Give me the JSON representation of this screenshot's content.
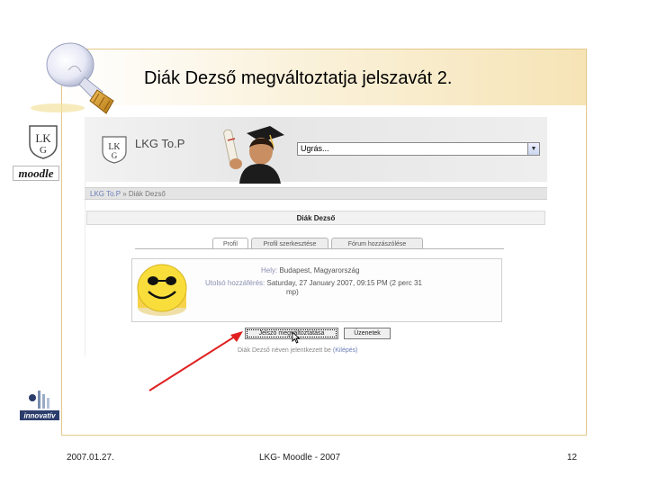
{
  "slide": {
    "title": "Diák Dezső megváltoztatja jelszavát 2.",
    "footer_date": "2007.01.27.",
    "footer_center": "LKG- Moodle - 2007",
    "page_number": "12"
  },
  "logos": {
    "moodle": "moodle",
    "innov_text": "innovatív"
  },
  "moodle_page": {
    "site_name": "LKG To.P",
    "jump_select": "Ugrás...",
    "breadcrumb_site": "LKG To.P",
    "breadcrumb_sep": "»",
    "breadcrumb_user": "Diák Dezső",
    "user_heading": "Diák Dezső",
    "tabs": [
      "Profil",
      "Profil szerkesztése",
      "Fórum hozzászólése"
    ],
    "place_label": "Hely:",
    "place_value": "Budapest, Magyarország",
    "last_access_label": "Utolsó hozzáférés:",
    "last_access_value": "Saturday, 27 January 2007, 09:15 PM  (2 perc 31",
    "last_access_value2": "mp)",
    "change_password_button": "Jelszó megváltoztatása",
    "messages_button": "Üzenetek",
    "logged_in_prefix": "Diák Dezső néven jelentkezett be",
    "logout_link": "(Kilépés)"
  },
  "colors": {
    "arrow": "#e02020",
    "title_band": "#f6e4b6"
  }
}
